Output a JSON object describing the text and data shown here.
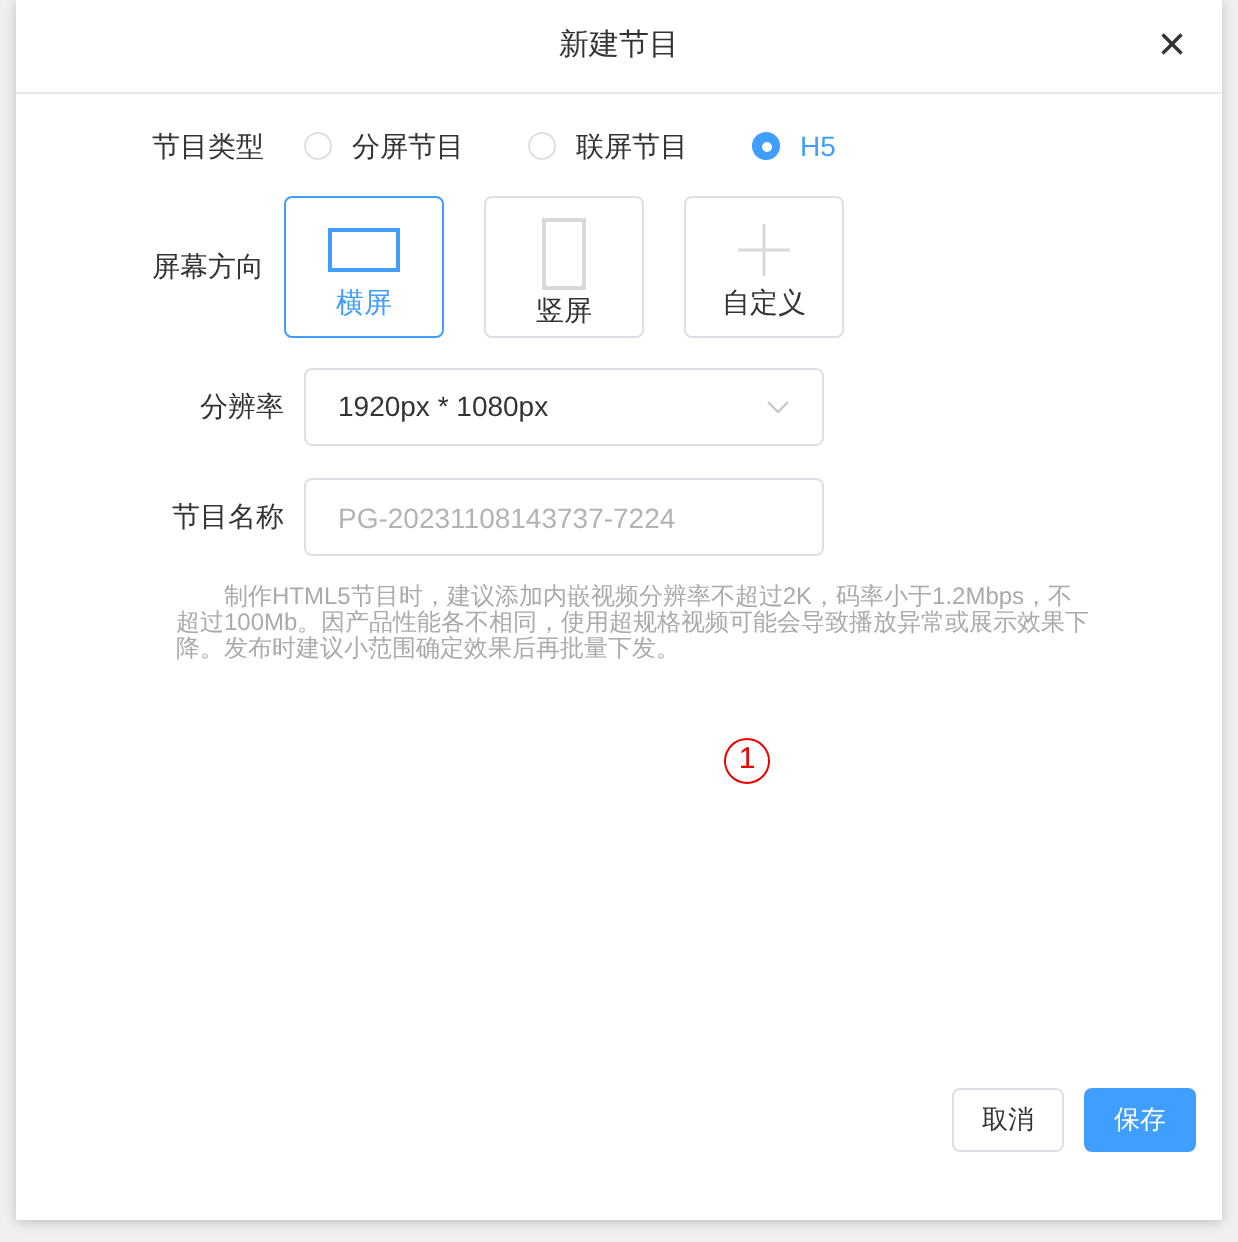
{
  "dialog": {
    "title": "新建节目",
    "close": "×"
  },
  "program_type": {
    "label": "节目类型",
    "options": [
      {
        "label": "分屏节目",
        "selected": false
      },
      {
        "label": "联屏节目",
        "selected": false
      },
      {
        "label": "H5",
        "selected": true
      }
    ]
  },
  "orientation": {
    "label": "屏幕方向",
    "options": [
      {
        "label": "横屏",
        "kind": "landscape",
        "selected": true
      },
      {
        "label": "竖屏",
        "kind": "portrait",
        "selected": false
      },
      {
        "label": "自定义",
        "kind": "custom",
        "selected": false
      }
    ]
  },
  "resolution": {
    "label": "分辨率",
    "value": "1920px * 1080px"
  },
  "program_name": {
    "label": "节目名称",
    "placeholder": "PG-20231108143737-7224"
  },
  "note": "制作HTML5节目时，建议添加内嵌视频分辨率不超过2K，码率小于1.2Mbps，不超过100Mb。因产品性能各不相同，使用超规格视频可能会导致播放异常或展示效果下降。发布时建议小范围确定效果后再批量下发。",
  "annotation": "1",
  "buttons": [
    {
      "label": "取消",
      "kind": "default"
    },
    {
      "label": "保存",
      "kind": "primary"
    }
  ]
}
